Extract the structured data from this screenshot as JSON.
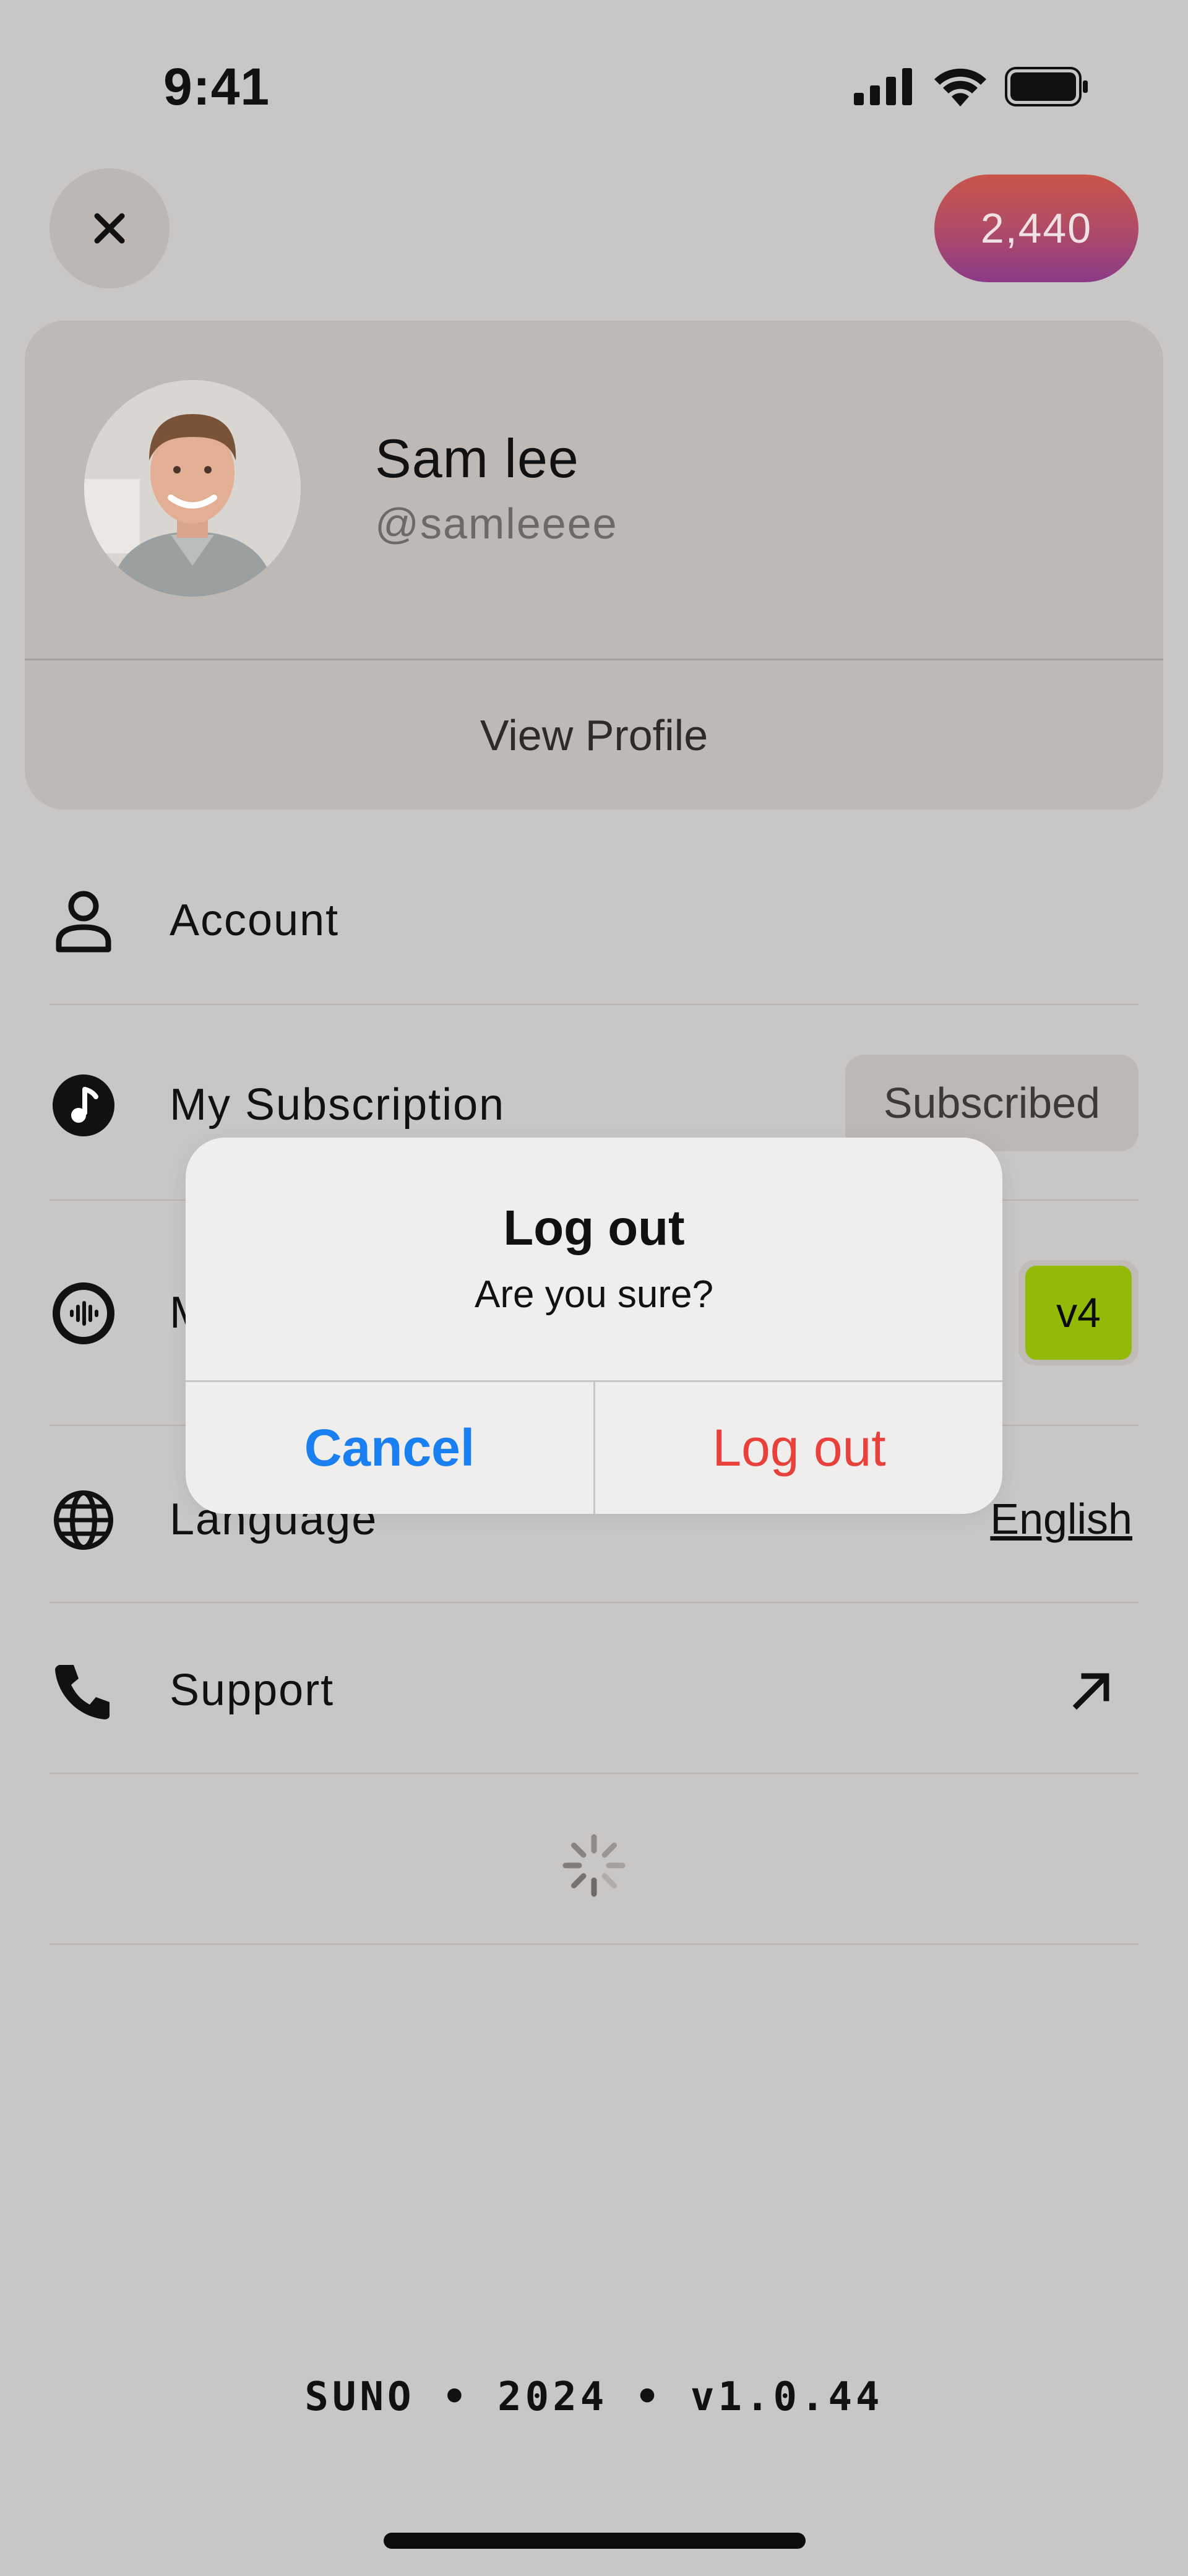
{
  "status_bar": {
    "time": "9:41",
    "icons": [
      "signal-icon",
      "wifi-icon",
      "battery-icon"
    ]
  },
  "header": {
    "close_icon": "close-icon",
    "credits": "2,440"
  },
  "profile": {
    "name": "Sam lee",
    "handle": "@samleeee",
    "view_profile_label": "View Profile"
  },
  "settings": {
    "account": {
      "label": "Account",
      "icon": "person-icon"
    },
    "subscription": {
      "label": "My Subscription",
      "icon": "music-note-icon",
      "status": "Subscribed"
    },
    "model": {
      "label": "M",
      "icon": "waveform-icon",
      "badge": "v4",
      "badge_color": "#93ba07"
    },
    "language": {
      "label": "Language",
      "icon": "globe-icon",
      "value": "English"
    },
    "support": {
      "label": "Support",
      "icon": "phone-icon",
      "action_icon": "arrow-up-right-icon"
    }
  },
  "footer": {
    "text": "SUNO • 2024 • v1.0.44"
  },
  "dialog": {
    "title": "Log out",
    "message": "Are you sure?",
    "cancel_label": "Cancel",
    "confirm_label": "Log out",
    "cancel_color": "#1a7ff0",
    "confirm_color": "#e8403a"
  }
}
